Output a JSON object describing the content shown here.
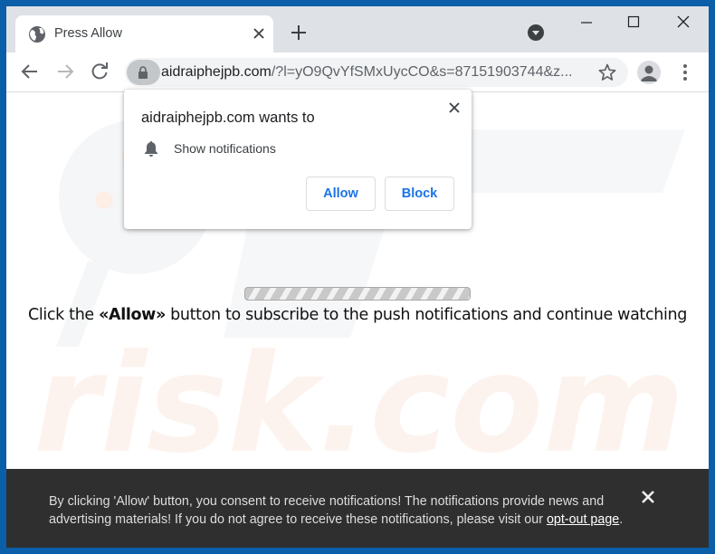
{
  "browser": {
    "tab": {
      "title": "Press Allow",
      "favicon": "globe-icon",
      "close_icon": "close-icon"
    },
    "new_tab_icon": "plus-icon",
    "tab_search_icon": "chevron-down-circle-icon",
    "window_controls": {
      "minimize_icon": "minimize-icon",
      "maximize_icon": "maximize-icon",
      "close_icon": "close-icon"
    },
    "toolbar": {
      "back_icon": "arrow-left-icon",
      "forward_icon": "arrow-right-icon",
      "reload_icon": "reload-icon",
      "lock_icon": "lock-icon",
      "url_host": "aidraiphejpb.com",
      "url_rest": "/?l=yO9QvYfSMxUycCO&s=87151903744&z...",
      "bookmark_icon": "star-icon",
      "profile_icon": "person-icon",
      "menu_icon": "kebab-menu-icon"
    }
  },
  "permission_popup": {
    "title": "aidraiphejpb.com wants to",
    "item_icon": "bell-icon",
    "item_label": "Show notifications",
    "allow_label": "Allow",
    "block_label": "Block",
    "close_icon": "close-icon"
  },
  "page": {
    "progress": {
      "state": "indeterminate"
    },
    "message_prefix": "Click the ",
    "message_bold": "«Allow»",
    "message_suffix": " button to subscribe to the push notifications and continue watching",
    "watermark": "PC risk.com"
  },
  "banner": {
    "text": "By clicking 'Allow' button, you consent to receive notifications! The notifications provide news and advertising materials! If you do not agree to receive these notifications, please visit our ",
    "link_label": "opt-out page",
    "text_end": ".",
    "close_icon": "close-icon"
  },
  "colors": {
    "desktop": "#0b5ea8",
    "tabstrip": "#dee1e6",
    "accent_blue": "#1a73e8",
    "banner_bg": "#2f2f2f"
  }
}
